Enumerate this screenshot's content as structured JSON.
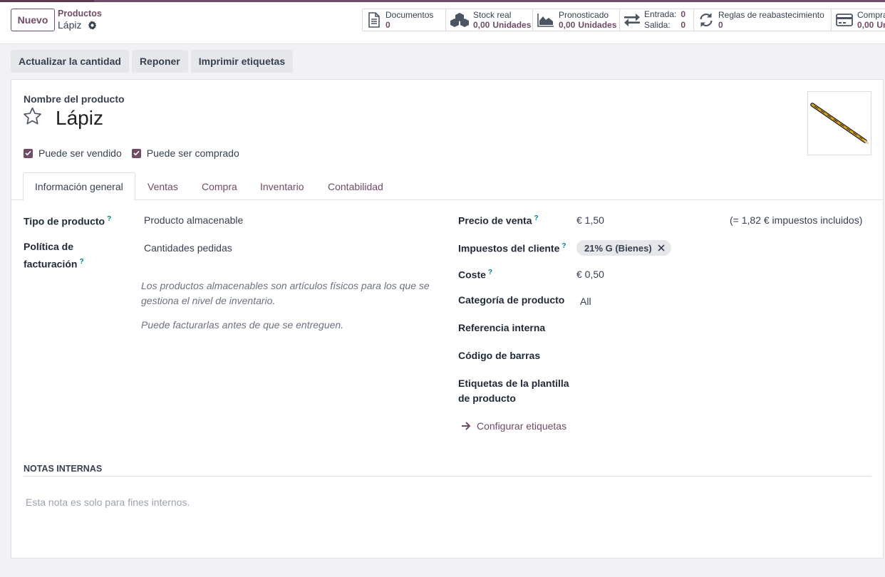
{
  "header": {
    "new_button": "Nuevo",
    "breadcrumb_parent": "Productos",
    "breadcrumb_current": "Lápiz"
  },
  "smart_buttons": {
    "documents": {
      "label": "Documentos",
      "value": "0"
    },
    "stock": {
      "label": "Stock real",
      "value": "0,00",
      "unit": "Unidades"
    },
    "forecast": {
      "label": "Pronosticado",
      "value": "0,00",
      "unit": "Unidades"
    },
    "moves": {
      "in_label": "Entrada:",
      "in_value": "0",
      "out_label": "Salida:",
      "out_value": "0"
    },
    "reorder": {
      "label": "Reglas de reabastecimiento",
      "value": "0"
    },
    "purchase": {
      "label": "Compra",
      "value": "0,00",
      "unit": "Un"
    }
  },
  "actions": [
    "Actualizar la cantidad",
    "Reponer",
    "Imprimir etiquetas"
  ],
  "form": {
    "name_label": "Nombre del producto",
    "name": "Lápiz",
    "can_be_sold": {
      "label": "Puede ser vendido",
      "checked": true
    },
    "can_be_purchased": {
      "label": "Puede ser comprado",
      "checked": true
    }
  },
  "tabs": [
    "Información general",
    "Ventas",
    "Compra",
    "Inventario",
    "Contabilidad"
  ],
  "general": {
    "product_type_label": "Tipo de producto",
    "product_type_value": "Producto almacenable",
    "invoice_policy_label_1": "Política de",
    "invoice_policy_label_2": "facturación",
    "invoice_policy_value": "Cantidades pedidas",
    "help_1_line_1": "Los productos almacenables son artículos físicos para los que se",
    "help_1_line_2": "gestiona el nivel de inventario.",
    "help_2": "Puede facturarlas antes de que se entreguen.",
    "help_marker": "?",
    "sales_price_label": "Precio de venta",
    "sales_price_value": "€ 1,50",
    "sales_price_tax_note": "(= 1,82 € impuestos incluidos)",
    "customer_taxes_label": "Impuestos del cliente",
    "customer_tax_tag": "21% G (Bienes)",
    "cost_label": "Coste",
    "cost_value": "€ 0,50",
    "category_label": "Categoría de producto",
    "category_value": "All",
    "internal_ref_label": "Referencia interna",
    "barcode_label": "Código de barras",
    "template_tags_label_1": "Etiquetas de la plantilla",
    "template_tags_label_2": "de producto",
    "configure_tags_link": "Configurar etiquetas"
  },
  "notes": {
    "title": "NOTAS INTERNAS",
    "placeholder": "Esta nota es solo para fines internos."
  },
  "colors": {
    "brand": "#714b67",
    "help_marker": "#017e84",
    "background": "#f2f2f4"
  },
  "icons": [
    "gear-icon",
    "document-icon",
    "cubes-icon",
    "area-chart-icon",
    "exchange-icon",
    "refresh-icon",
    "credit-card-icon",
    "star-icon",
    "check-icon",
    "close-icon",
    "arrow-right-icon",
    "pencil-image"
  ]
}
